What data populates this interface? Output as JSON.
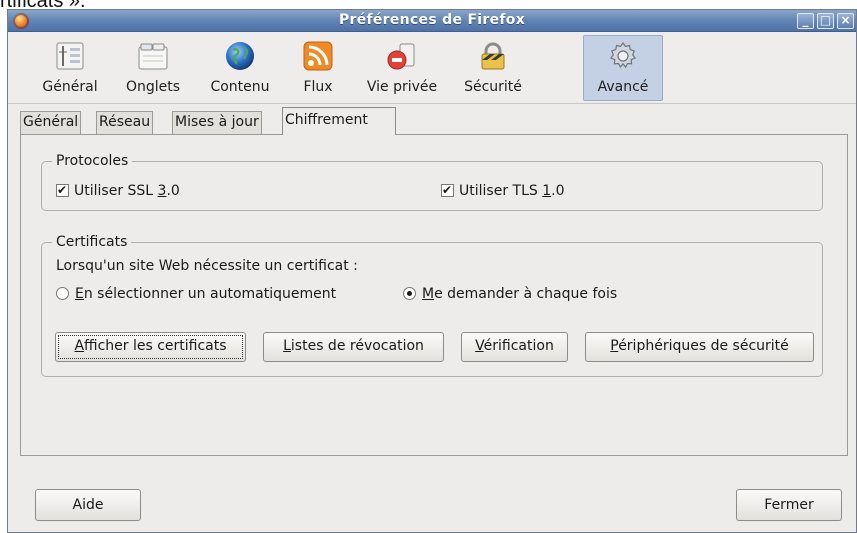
{
  "caption": "rtificats ».",
  "window": {
    "title": "Préférences de Firefox",
    "controls": {
      "minimize": "_",
      "maximize": "□",
      "close": "×"
    }
  },
  "panes": [
    {
      "label": "Général",
      "icon": "general-pane-icon"
    },
    {
      "label": "Onglets",
      "icon": "tabs-pane-icon"
    },
    {
      "label": "Contenu",
      "icon": "content-globe-icon"
    },
    {
      "label": "Flux",
      "icon": "rss-feed-icon"
    },
    {
      "label": "Vie privée",
      "icon": "privacy-icon"
    },
    {
      "label": "Sécurité",
      "icon": "security-padlock-icon"
    },
    {
      "label": "Avancé",
      "icon": "gear-icon",
      "selected": true
    }
  ],
  "tabs": [
    {
      "label": "Général"
    },
    {
      "label": "Réseau"
    },
    {
      "label": "Mises à jour"
    },
    {
      "label": "Chiffrement",
      "active": true
    }
  ],
  "protocols": {
    "legend": "Protocoles",
    "ssl": {
      "prefix": "Utiliser SSL ",
      "mnemonic": "3",
      "suffix": ".0",
      "checked": true
    },
    "tls": {
      "prefix": "Utiliser TLS ",
      "mnemonic": "1",
      "suffix": ".0",
      "checked": true
    }
  },
  "certificates": {
    "legend": "Certificats",
    "prompt": "Lorsqu'un site Web nécessite un certificat :",
    "auto": {
      "mnemonic": "E",
      "rest": "n sélectionner un automatiquement",
      "selected": false
    },
    "ask": {
      "mnemonic": "M",
      "rest": "e demander à chaque fois",
      "selected": true
    },
    "buttons": {
      "show": {
        "mnemonic": "A",
        "rest": "fficher les certificats"
      },
      "revocation": {
        "mnemonic": "L",
        "rest": "istes de révocation"
      },
      "verification": {
        "mnemonic": "V",
        "rest": "érification"
      },
      "devices": {
        "mnemonic": "P",
        "rest": "ériphériques de sécurité"
      }
    }
  },
  "footer": {
    "help": "Aide",
    "close": "Fermer"
  },
  "colors": {
    "titlebar": "#5f82b3",
    "selected_pane": "#c4d0e3",
    "window_bg": "#edeceb"
  }
}
